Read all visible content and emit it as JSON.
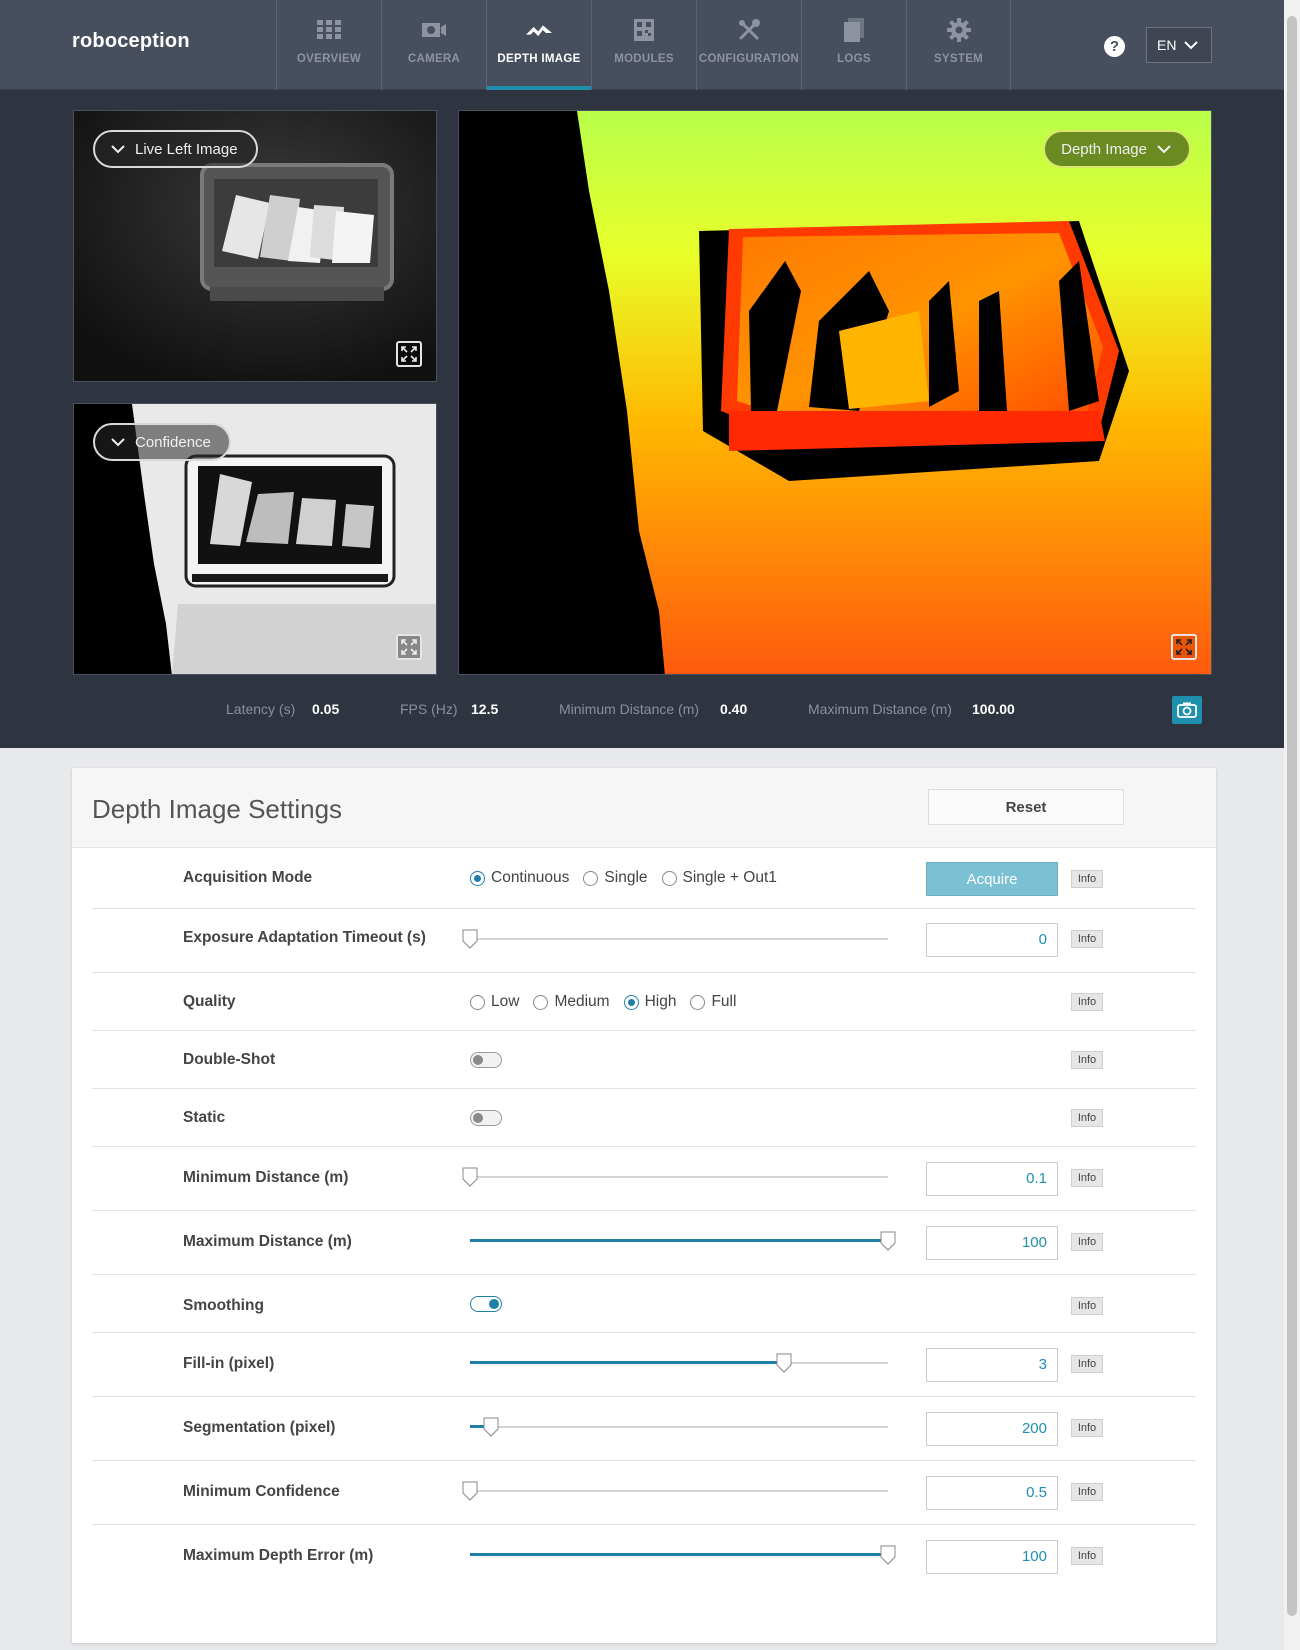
{
  "brand": {
    "logo": "roboception"
  },
  "nav": {
    "items": [
      {
        "label": "OVERVIEW",
        "icon": "grid-icon"
      },
      {
        "label": "CAMERA",
        "icon": "camera-icon"
      },
      {
        "label": "DEPTH IMAGE",
        "icon": "depth-image-icon",
        "active": true
      },
      {
        "label": "MODULES",
        "icon": "modules-icon"
      },
      {
        "label": "CONFIGURATION",
        "icon": "tools-icon"
      },
      {
        "label": "LOGS",
        "icon": "document-icon"
      },
      {
        "label": "SYSTEM",
        "icon": "gear-icon"
      }
    ],
    "help": "?",
    "language": "EN"
  },
  "viewer": {
    "left_panel_label": "Live Left Image",
    "confidence_panel_label": "Confidence",
    "main_panel_label": "Depth Image"
  },
  "stats": {
    "latency_label": "Latency (s)",
    "latency_value": "0.05",
    "fps_label": "FPS (Hz)",
    "fps_value": "12.5",
    "min_dist_label": "Minimum Distance (m)",
    "min_dist_value": "0.40",
    "max_dist_label": "Maximum Distance (m)",
    "max_dist_value": "100.00"
  },
  "settings": {
    "title": "Depth Image Settings",
    "reset_label": "Reset",
    "info_label": "Info",
    "acquire_label": "Acquire",
    "acquisition_mode": {
      "label": "Acquisition Mode",
      "options": [
        "Continuous",
        "Single",
        "Single + Out1"
      ],
      "selected": "Continuous"
    },
    "exposure_timeout": {
      "label": "Exposure Adaptation Timeout (s)",
      "value": "0",
      "level": 0
    },
    "quality": {
      "label": "Quality",
      "options": [
        "Low",
        "Medium",
        "High",
        "Full"
      ],
      "selected": "High"
    },
    "double_shot": {
      "label": "Double-Shot",
      "enabled": false
    },
    "static": {
      "label": "Static",
      "enabled": false
    },
    "min_distance": {
      "label": "Minimum Distance (m)",
      "value": "0.1",
      "level": 0
    },
    "max_distance": {
      "label": "Maximum Distance (m)",
      "value": "100",
      "level": 1
    },
    "smoothing": {
      "label": "Smoothing",
      "enabled": true
    },
    "fill_in": {
      "label": "Fill-in (pixel)",
      "value": "3",
      "level": 0.75
    },
    "segmentation": {
      "label": "Segmentation (pixel)",
      "value": "200",
      "level": 0.05
    },
    "min_confidence": {
      "label": "Minimum Confidence",
      "value": "0.5",
      "level": 0
    },
    "max_depth_error": {
      "label": "Maximum Depth Error (m)",
      "value": "100",
      "level": 1
    }
  },
  "colors": {
    "accent": "#1f8fae",
    "nav_bg": "#474e5d",
    "viewer_bg": "#2f3540"
  }
}
